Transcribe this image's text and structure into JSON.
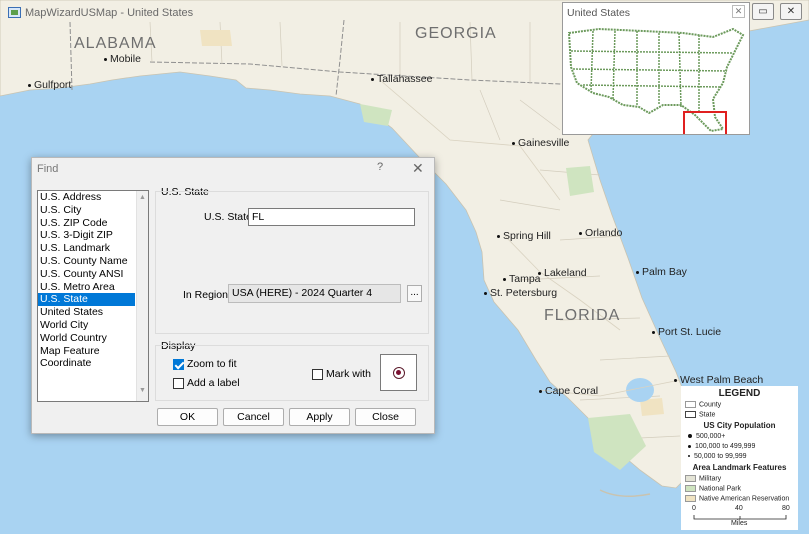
{
  "window": {
    "title": "MapWizardUSMap - United States",
    "restore_glyph": "▭",
    "close_glyph": "✕"
  },
  "map": {
    "state_labels": [
      "ALABAMA",
      "GEORGIA",
      "FLORIDA"
    ],
    "cities": [
      "Mobile",
      "Gulfport",
      "Tallahassee",
      "Gainesville",
      "Spring Hill",
      "Orlando",
      "Tampa",
      "Lakeland",
      "St. Petersburg",
      "Palm Bay",
      "Port St. Lucie",
      "West Palm Beach",
      "Cape Coral"
    ]
  },
  "overview": {
    "title": "United States",
    "close_glyph": "✕"
  },
  "legend": {
    "title": "LEGEND",
    "county": "County",
    "state": "State",
    "population_title": "US City Population",
    "population": [
      "500,000+",
      "100,000 to 499,999",
      "50,000 to 99,999"
    ],
    "landmark_title": "Area Landmark Features",
    "landmarks": [
      {
        "label": "Military",
        "color": "#e4e4d6"
      },
      {
        "label": "National Park",
        "color": "#cfe4c0"
      },
      {
        "label": "Native American Reservation",
        "color": "#f0e3c2"
      }
    ],
    "scale_ticks": [
      "0",
      "40",
      "80"
    ],
    "scale_unit": "Miles"
  },
  "dialog": {
    "title": "Find",
    "help": "?",
    "close": "✕",
    "search_types": [
      "U.S. Address",
      "U.S. City",
      "U.S. ZIP Code",
      "U.S. 3-Digit ZIP",
      "U.S. Landmark",
      "U.S. County Name",
      "U.S. County ANSI",
      "U.S. Metro Area",
      "U.S. State",
      "United States",
      "World City",
      "World Country",
      "Map Feature",
      "Coordinate"
    ],
    "selected_index": 8,
    "group_title": "U.S. State",
    "state_label": "U.S. State",
    "state_value": "FL",
    "region_label": "In Region",
    "region_value": "USA (HERE) - 2024 Quarter 4",
    "browse_label": "...",
    "display_title": "Display",
    "zoom_label": "Zoom to fit",
    "zoom_checked": true,
    "label_label": "Add a label",
    "label_checked": false,
    "mark_label": "Mark with",
    "mark_checked": false,
    "buttons": {
      "ok": "OK",
      "cancel": "Cancel",
      "apply": "Apply",
      "close": "Close"
    },
    "scroll_up": "▲",
    "scroll_down": "▼"
  },
  "colors": {
    "land": "#f2efe4",
    "water": "#a9d3f2",
    "park": "#cfe4c0",
    "selection": "#0078d7",
    "overview_state_border": "#6c9a5c",
    "overview_highlight": "#e02020"
  }
}
